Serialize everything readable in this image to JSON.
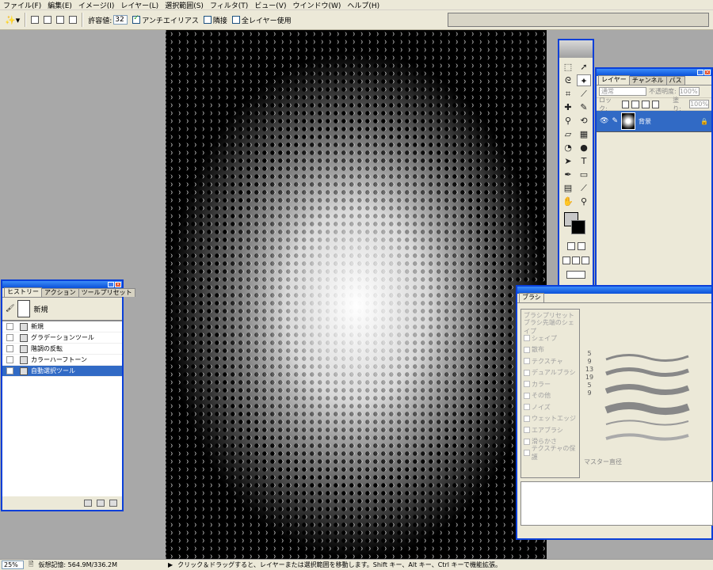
{
  "menu": [
    "ファイル(F)",
    "編集(E)",
    "イメージ(I)",
    "レイヤー(L)",
    "選択範囲(S)",
    "フィルタ(T)",
    "ビュー(V)",
    "ウインドウ(W)",
    "ヘルプ(H)"
  ],
  "options": {
    "tolerance_label": "許容値:",
    "tolerance_value": "32",
    "antialias_label": "アンチエイリアス",
    "contiguous_label": "隣接",
    "all_layers_label": "全レイヤー使用"
  },
  "history": {
    "tabs": [
      "ヒストリー",
      "アクション",
      "ツールプリセット"
    ],
    "snapshot_label": "新規",
    "items": [
      "新規",
      "グラデーションツール",
      "階調の反転",
      "カラーハーフトーン",
      "自動選択ツール"
    ]
  },
  "layers": {
    "tabs": [
      "レイヤー",
      "チャンネル",
      "パス"
    ],
    "blend_mode": "通常",
    "opacity_label": "不透明度:",
    "opacity_value": "100%",
    "lock_label": "ロック:",
    "fill_label": "塗り:",
    "fill_value": "100%",
    "layer_name": "背景"
  },
  "brush": {
    "tab": "ブラシ",
    "items": [
      "ブラシプリセット",
      "ブラシ先端のシェイプ",
      "シェイプ",
      "散布",
      "テクスチャ",
      "デュアルブラシ",
      "カラー",
      "その他",
      "ノイズ",
      "ウェットエッジ",
      "エアブラシ",
      "滑らかさ",
      "テクスチャの保護"
    ],
    "sizes": [
      "5",
      "9",
      "13",
      "19",
      "5",
      "9"
    ],
    "master_label": "マスター直径"
  },
  "status": {
    "zoom": "25%",
    "memory": "仮想記憶: 564.9M/336.2M",
    "hint": "クリック＆ドラッグすると、レイヤーまたは選択範囲を移動します。Shift キー、Alt キー、Ctrl キーで機能拡張。"
  }
}
